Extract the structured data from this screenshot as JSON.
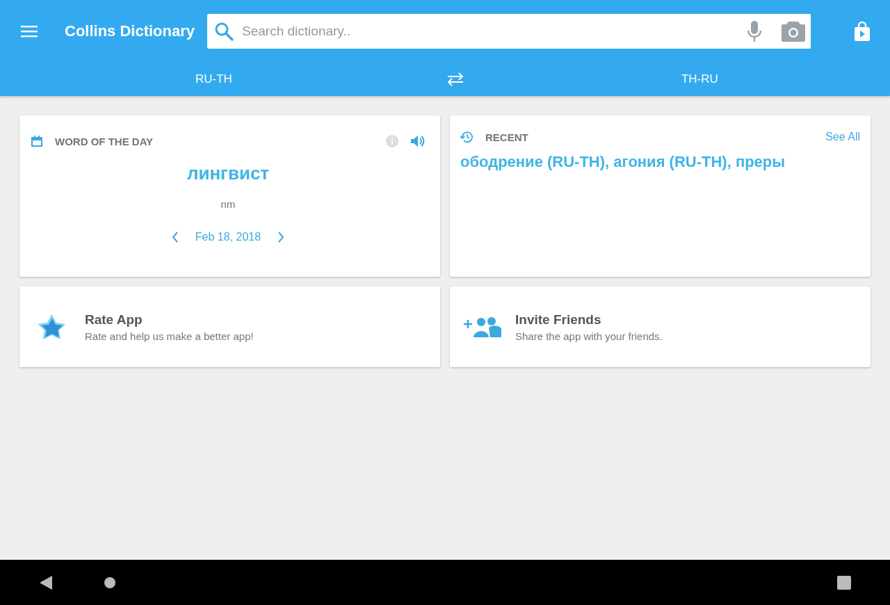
{
  "app_bar": {
    "title": "Collins Dictionary",
    "search": {
      "placeholder": "Search dictionary.."
    }
  },
  "language_tabs": [
    {
      "label": "RU-TH"
    },
    {
      "label": "TH-RU"
    }
  ],
  "word_of_the_day": {
    "heading": "WORD OF THE DAY",
    "word": "лингвист",
    "part_of_speech": "nm",
    "date": "Feb 18, 2018"
  },
  "recent": {
    "heading": "RECENT",
    "link": "See All",
    "words": "ободрение (RU-TH), агония (RU-TH), преры"
  },
  "actions": [
    {
      "kind": "rate",
      "title": "Rate App",
      "subtitle": "Rate and help us make a better app!"
    },
    {
      "kind": "invite",
      "title": "Invite Friends",
      "subtitle": "Share the app with your friends."
    }
  ]
}
